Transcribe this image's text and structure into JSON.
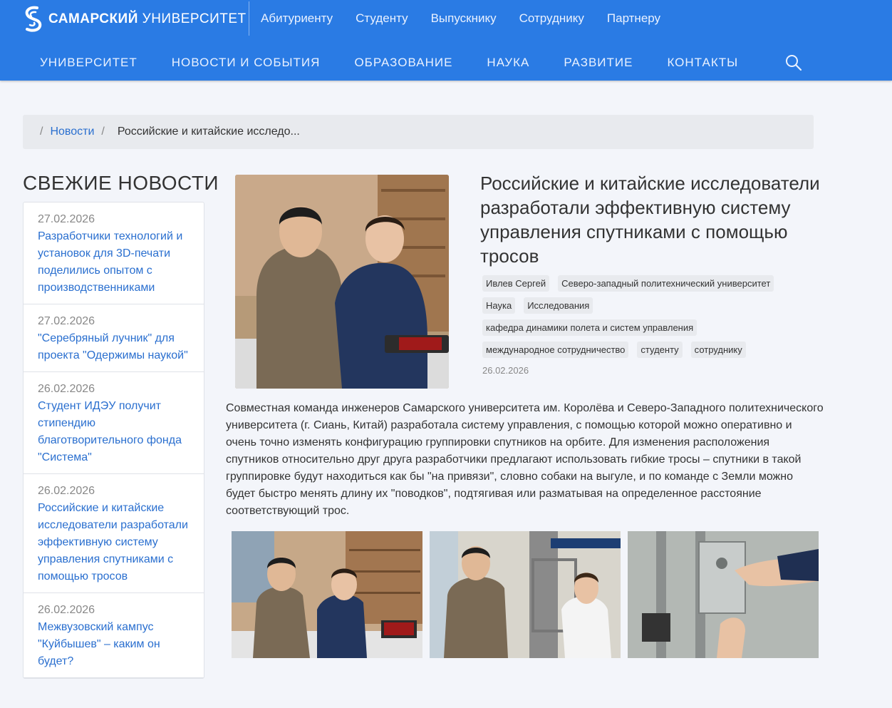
{
  "header": {
    "logo_bold": "САМАРСКИЙ",
    "logo_light": "УНИВЕРСИТЕТ",
    "top_links": [
      "Абитуриенту",
      "Студенту",
      "Выпускнику",
      "Сотруднику",
      "Партнеру"
    ],
    "main_nav": [
      "УНИВЕРСИТЕТ",
      "НОВОСТИ И СОБЫТИЯ",
      "ОБРАЗОВАНИЕ",
      "НАУКА",
      "РАЗВИТИЕ",
      "КОНТАКТЫ"
    ],
    "search_icon": "search-icon",
    "colors": {
      "bar": "#2a7be4",
      "link": "#2a6fcf"
    }
  },
  "breadcrumb": {
    "separator": "/",
    "news_link": "Новости",
    "current": "Российские и китайские исследо..."
  },
  "sidebar": {
    "title": "СВЕЖИЕ НОВОСТИ",
    "items": [
      {
        "date": "27.02.2026",
        "title": "Разработчики технологий и установок для 3D-печати поделились опытом с производственниками"
      },
      {
        "date": "27.02.2026",
        "title": "\"Серебряный лучник\" для проекта \"Одержимы наукой\""
      },
      {
        "date": "26.02.2026",
        "title": "Студент ИДЭУ получит стипендию благотворительного фонда \"Система\""
      },
      {
        "date": "26.02.2026",
        "title": "Российские и китайские исследователи разработали эффективную систему управления спутниками с помощью тросов"
      },
      {
        "date": "26.02.2026",
        "title": "Межвузовский кампус \"Куйбышев\" – каким он будет?"
      }
    ]
  },
  "article": {
    "title": "Российские и китайские исследователи разработали эффективную систему управления спутниками с помощью тросов",
    "tags": {
      "row1": [
        "Ивлев Сергей",
        "Северо-западный политехнический университет"
      ],
      "row2": [
        "Наука",
        "Исследования"
      ],
      "row3": [
        "кафедра динамики полета и систем управления"
      ],
      "row4": [
        "международное сотрудничество",
        "студенту",
        "сотруднику"
      ]
    },
    "date": "26.02.2026",
    "body": "Совместная команда инженеров Самарского университета им. Королёва и Северо-Западного политехнического университета (г. Сиань, Китай) разработала систему управления, с помощью которой можно оперативно и очень точно изменять конфигурацию группировки спутников на орбите. Для изменения расположения спутников относительно друг друга разработчики предлагают использовать гибкие тросы – спутники в такой группировке будут находиться как бы \"на привязи\", словно собаки на выгуле, и по команде с Земли можно будет быстро менять длину их \"поводков\", подтягивая или разматывая на определенное расстояние соответствующий трос."
  }
}
